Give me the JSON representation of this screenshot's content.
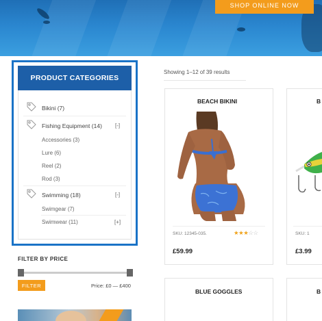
{
  "hero": {
    "cta_label": "SHOP ONLINE NOW"
  },
  "categories": {
    "title": "PRODUCT CATEGORIES",
    "items": [
      {
        "label": "Bikini",
        "count": "(7)"
      },
      {
        "label": "Fishing Equipment",
        "count": "(14)",
        "toggle": "[-]",
        "children": [
          {
            "label": "Accessories",
            "count": "(3)"
          },
          {
            "label": "Lure",
            "count": "(6)"
          },
          {
            "label": "Reel",
            "count": "(2)"
          },
          {
            "label": "Rod",
            "count": "(3)"
          }
        ]
      },
      {
        "label": "Swimming",
        "count": "(18)",
        "toggle": "[-]",
        "children": [
          {
            "label": "Swimgear",
            "count": "(7)"
          },
          {
            "label": "Swimwear",
            "count": "(11)",
            "toggle": "[+]"
          }
        ]
      }
    ]
  },
  "price_filter": {
    "title": "FILTER BY PRICE",
    "button_label": "FILTER",
    "range_label": "Price: £0 — £400"
  },
  "results": {
    "showing_text": "Showing 1–12 of 39 results",
    "products": [
      {
        "title": "BEACH BIKINI",
        "sku": "SKU: 12345-035.",
        "rating": 3,
        "rating_max": 5,
        "price": "£59.99"
      },
      {
        "title": "B",
        "sku": "SKU: 1",
        "price": "£3.99"
      },
      {
        "title": "BLUE GOGGLES"
      },
      {
        "title": "B"
      }
    ]
  },
  "colors": {
    "accent_orange": "#f39c1c",
    "header_blue": "#1d5fa8",
    "highlight_blue": "#1a73c7"
  }
}
